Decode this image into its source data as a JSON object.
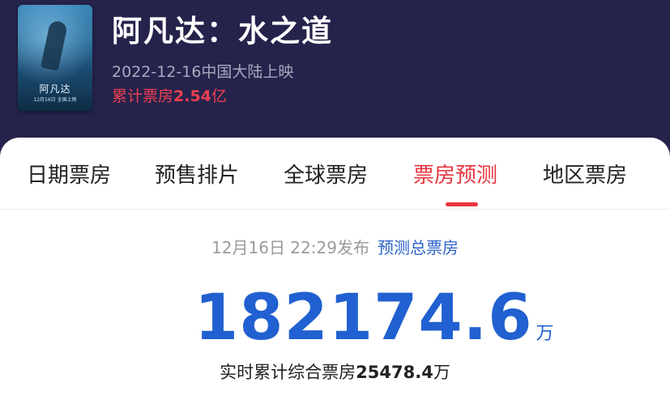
{
  "movie": {
    "title": "阿凡达：水之道",
    "release": "2022-12-16中国大陆上映",
    "box_label": "累计票房",
    "box_value": "2.54",
    "box_unit": "亿",
    "poster": {
      "title": "阿凡达",
      "subtitle": "12月16日 全国上映"
    }
  },
  "tabs": [
    {
      "label": "日期票房",
      "active": false
    },
    {
      "label": "预售排片",
      "active": false
    },
    {
      "label": "全球票房",
      "active": false
    },
    {
      "label": "票房预测",
      "active": true
    },
    {
      "label": "地区票房",
      "active": false
    }
  ],
  "forecast": {
    "published": "12月16日 22:29发布",
    "link": "预测总票房",
    "value": "182174.6",
    "unit": "万",
    "realtime_label": "实时累计综合票房",
    "realtime_value": "25478.4",
    "realtime_unit": "万"
  },
  "colors": {
    "header_bg": "#25234b",
    "accent_red": "#e8343f",
    "accent_blue": "#2160d0"
  }
}
